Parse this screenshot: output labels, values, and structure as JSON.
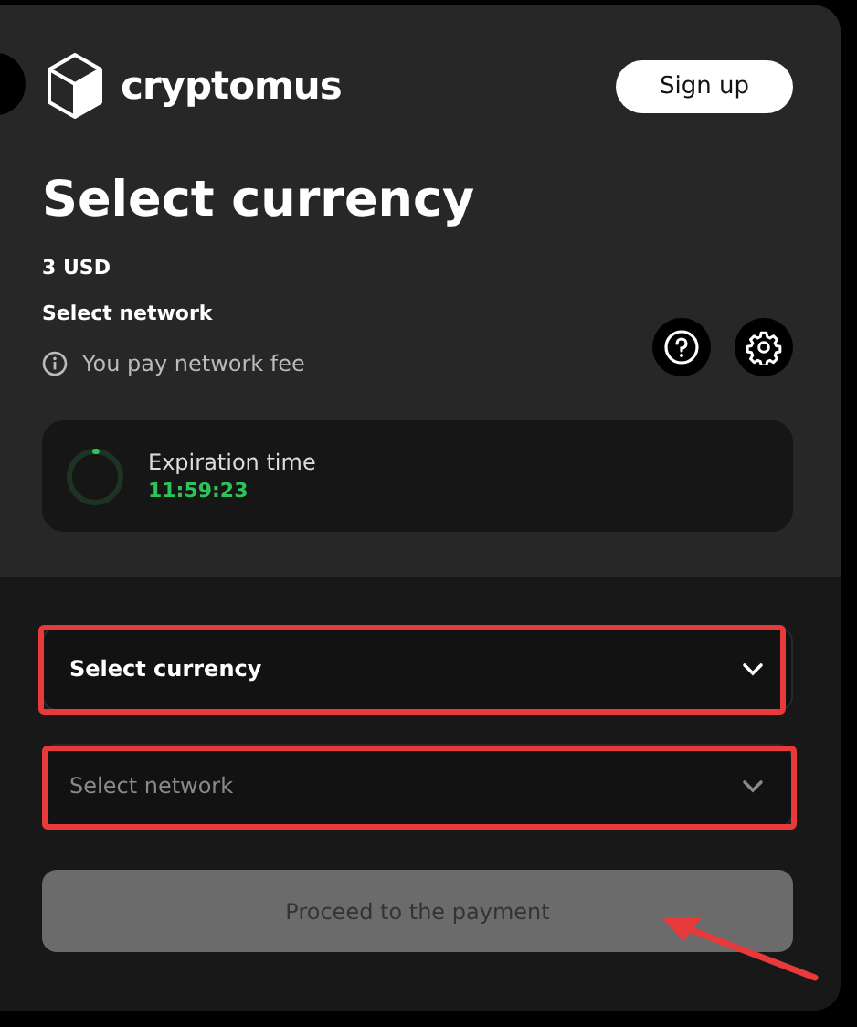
{
  "brand": {
    "name": "cryptomus"
  },
  "sign_up": {
    "label": "Sign up"
  },
  "title": "Select currency",
  "amount": "3 USD",
  "network": "Select network",
  "fee_note": "You pay network fee",
  "timer": {
    "label": "Expiration time",
    "value": "11:59:23",
    "level": 0.01
  },
  "dropdowns": [
    {
      "label": "Select currency",
      "disabled": false,
      "highlighted": true
    },
    {
      "label": "Select network",
      "disabled": true,
      "highlighted": true
    }
  ],
  "proceed": {
    "label": "Proceed to the payment",
    "disabled": true,
    "arrow_annotation": true
  }
}
